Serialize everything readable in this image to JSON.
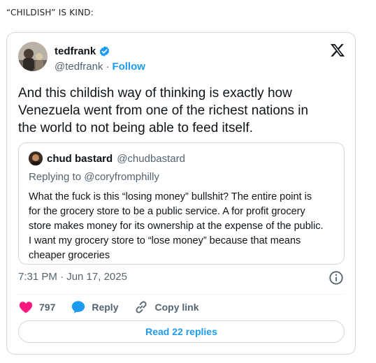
{
  "caption": "“CHILDISH” IS KIND:",
  "tweet": {
    "author_name": "tedfrank",
    "author_handle": "@tedfrank",
    "separator": "·",
    "follow_label": "Follow",
    "text_lines": [
      "And this childish way of thinking is exactly how",
      "Venezuela went from one of the richest nations in",
      "the world to not being able to feed itself."
    ],
    "timestamp": "7:31 PM · Jun 17, 2025"
  },
  "quoted_tweet": {
    "author_name": "chud bastard",
    "author_handle": "@chudbastard",
    "replying_to": "Replying to @coryfromphilly",
    "text_lines": [
      "What the fuck is this “losing money” bullshit? The entire point is",
      "for the grocery store to be a public service. A for profit grocery",
      "store makes money for its ownership at the expense of the public.",
      "I want my grocery store to “lose money” because that means",
      "cheaper groceries"
    ]
  },
  "actions": {
    "like_count": "797",
    "reply_label": "Reply",
    "copy_link_label": "Copy link",
    "read_replies_label": "Read 22 replies"
  },
  "colors": {
    "accent": "#1d9bf0",
    "like": "#f91880",
    "muted": "#536471",
    "border": "#cfd9de"
  },
  "icons": {
    "verified": "verified-badge-icon",
    "platform": "x-logo-icon",
    "info": "info-icon",
    "like": "heart-icon",
    "reply": "speech-bubble-icon",
    "link": "link-icon"
  }
}
